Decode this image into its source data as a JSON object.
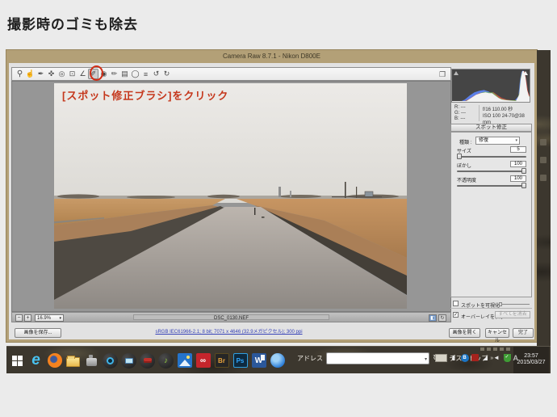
{
  "page": {
    "heading": "撮影時のゴミも除去"
  },
  "annotation": {
    "tool_callout": "[スポット修正ブラシ]をクリック"
  },
  "colors": {
    "accent_red": "#c5371c",
    "window_chrome": "#b3a077",
    "link_blue": "#3743b8"
  },
  "acr": {
    "title": "Camera Raw 8.7.1  -  Nikon D800E",
    "toolbar": [
      {
        "name": "zoom-tool",
        "glyph": "⚲"
      },
      {
        "name": "hand-tool",
        "glyph": "☝"
      },
      {
        "name": "white-balance-tool",
        "glyph": "✒"
      },
      {
        "name": "color-sampler-tool",
        "glyph": "✜"
      },
      {
        "name": "targeted-adjustment-tool",
        "glyph": "◎"
      },
      {
        "name": "crop-tool",
        "glyph": "⊡"
      },
      {
        "name": "straighten-tool",
        "glyph": "∠"
      },
      {
        "name": "spot-removal-tool",
        "glyph": "✐"
      },
      {
        "name": "red-eye-tool",
        "glyph": "◉"
      },
      {
        "name": "adjustment-brush-tool",
        "glyph": "✏"
      },
      {
        "name": "graduated-filter-tool",
        "glyph": "▤"
      },
      {
        "name": "radial-filter-tool",
        "glyph": "◯"
      },
      {
        "name": "preferences-button",
        "glyph": "≡"
      },
      {
        "name": "rotate-left-button",
        "glyph": "↺"
      },
      {
        "name": "rotate-right-button",
        "glyph": "↻"
      }
    ],
    "fullscreen_glyph": "❐",
    "histogram": {
      "r_label": "R:",
      "g_label": "G:",
      "b_label": "B:",
      "r_value": "---",
      "g_value": "---",
      "b_value": "---",
      "exposure": "f/16 110.00 秒",
      "iso": "ISO 100",
      "lens": "24-70@38 mm"
    },
    "spot_panel": {
      "title": "スポット修正",
      "type_label": "種類 :",
      "type_value": "修復",
      "sliders": [
        {
          "label": "サイズ",
          "value": "5"
        },
        {
          "label": "ぼかし",
          "value": "100"
        },
        {
          "label": "不透明度",
          "value": "100"
        }
      ],
      "visualize_label": "スポットを可視化",
      "overlay_label": "オーバーレイを表示",
      "overlay_check": "✓",
      "clear_all": "すべてを消去"
    },
    "statusbar": {
      "zoom_minus": "−",
      "zoom_plus": "+",
      "zoom_value": "16.9%",
      "filename": "DSC_0130.NEF"
    },
    "workflow_link": "sRGB IEC61966-2.1; 8 bit; 7071 x 4646 (32.9メガピクセル); 300 ppi",
    "buttons": {
      "save_image": "画像を保存...",
      "open_image": "画像を開く",
      "cancel": "キャンセル",
      "done": "完了"
    }
  },
  "taskbar": {
    "address_label": "アドレス",
    "desktop_label": "デスクトップ",
    "chevron": "»",
    "icon_letters": {
      "ie": "e",
      "cc": "∞",
      "bridge": "Br",
      "photoshop": "Ps",
      "word": "W",
      "music_note": "♪"
    },
    "tray": {
      "bluetooth_letter": "B",
      "network_glyph": "◢",
      "volume_glyph": "◄",
      "shield_check": "✓",
      "ime_mode": "A"
    },
    "clock_time": "23:57",
    "clock_date": "2015/03/27"
  }
}
